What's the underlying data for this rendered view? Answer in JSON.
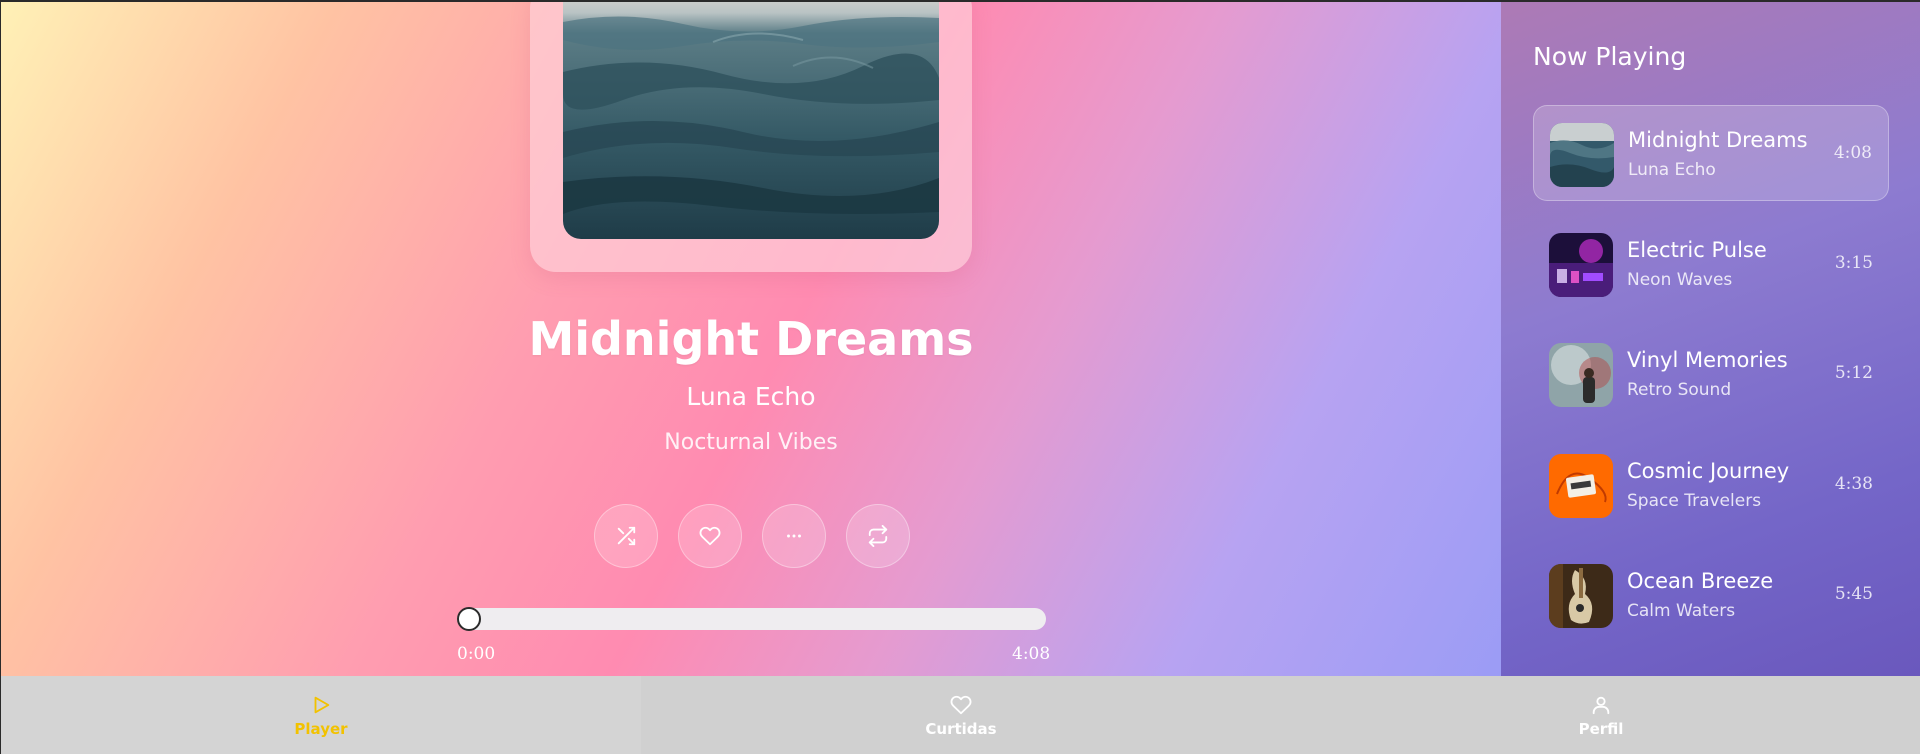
{
  "player": {
    "title": "Midnight Dreams",
    "artist": "Luna Echo",
    "album": "Nocturnal Vibes",
    "current_time": "0:00",
    "duration": "4:08",
    "progress": 0.0,
    "controls": {
      "shuffle_icon": "shuffle-icon",
      "like_icon": "heart-icon",
      "more_icon": "more-horizontal-icon",
      "repeat_icon": "repeat-icon"
    }
  },
  "queue": {
    "title": "Now Playing",
    "tracks": [
      {
        "title": "Midnight Dreams",
        "artist": "Luna Echo",
        "duration": "4:08",
        "active": true
      },
      {
        "title": "Electric Pulse",
        "artist": "Neon Waves",
        "duration": "3:15",
        "active": false
      },
      {
        "title": "Vinyl Memories",
        "artist": "Retro Sound",
        "duration": "5:12",
        "active": false
      },
      {
        "title": "Cosmic Journey",
        "artist": "Space Travelers",
        "duration": "4:38",
        "active": false
      },
      {
        "title": "Ocean Breeze",
        "artist": "Calm Waters",
        "duration": "5:45",
        "active": false
      }
    ]
  },
  "nav": {
    "items": [
      {
        "label": "Player",
        "icon": "play-icon",
        "active": true
      },
      {
        "label": "Curtidas",
        "icon": "heart-icon",
        "active": false
      },
      {
        "label": "Perfil",
        "icon": "user-icon",
        "active": false
      }
    ]
  },
  "colors": {
    "accent": "#f2c200",
    "nav_bg": "#d0d0d0",
    "sidebar_bg": "#7466c8"
  }
}
